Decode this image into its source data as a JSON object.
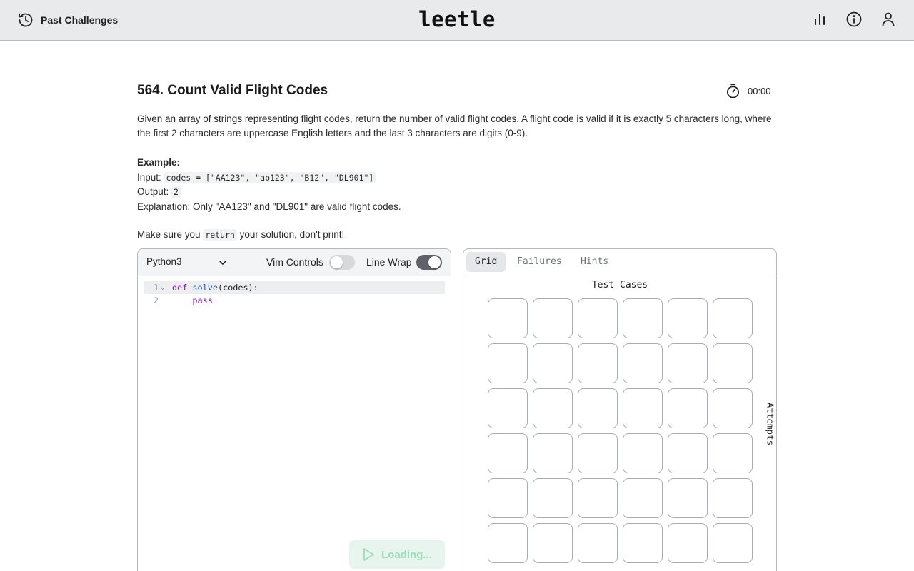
{
  "header": {
    "past_label": "Past Challenges",
    "logo": "leetle",
    "icons": [
      "stats-icon",
      "info-icon",
      "user-icon"
    ]
  },
  "problem": {
    "title": "564. Count Valid Flight Codes",
    "timer": "00:00",
    "description": "Given an array of strings representing flight codes, return the number of valid flight codes. A flight code is valid if it is exactly 5 characters long, where the first 2 characters are uppercase English letters and the last 3 characters are digits (0-9).",
    "example_heading": "Example:",
    "input_label": "Input:",
    "input_code": "codes = [\"AA123\", \"ab123\", \"B12\", \"DL901\"]",
    "output_label": "Output:",
    "output_code": "2",
    "explanation": "Explanation: Only \"AA123\" and \"DL901\" are valid flight codes.",
    "note_prefix": "Make sure you",
    "note_code": "return",
    "note_suffix": "your solution, don't print!"
  },
  "editor": {
    "language": "Python3",
    "vim_label": "Vim Controls",
    "vim_enabled": false,
    "wrap_label": "Line Wrap",
    "wrap_enabled": true,
    "lines": [
      {
        "num": "1",
        "tokens": [
          "def",
          "solve",
          "(codes):"
        ]
      },
      {
        "num": "2",
        "tokens": [
          "    ",
          "pass"
        ]
      }
    ],
    "run_label": "Loading..."
  },
  "panel": {
    "tabs": [
      "Grid",
      "Failures",
      "Hints"
    ],
    "active_tab": "Grid",
    "grid_title": "Test Cases",
    "side_label": "Attempts",
    "rows": 6,
    "cols": 6
  },
  "colors": {
    "topbar": "#e9eaec",
    "run_bg": "#e8f5ee",
    "run_text": "#9edcb6",
    "keyword": "#7a1fa2",
    "function": "#2b55a8"
  }
}
